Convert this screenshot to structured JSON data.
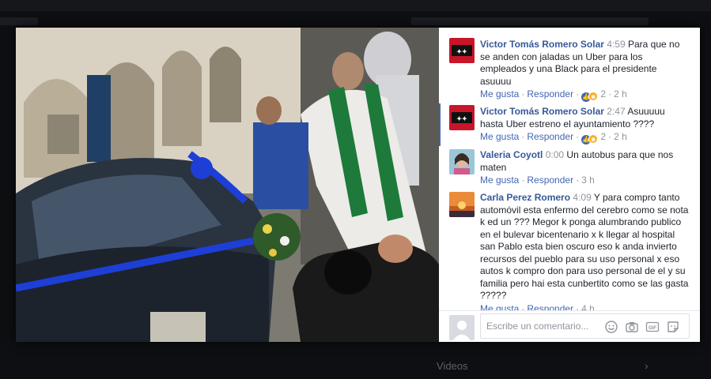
{
  "background": {
    "side_label": "Videos"
  },
  "comments": [
    {
      "author": "Victor Tomás Romero Solar",
      "time": "4:59",
      "text": "Para que no se anden con jaladas un Uber para los empleados y una Black para el presidente asuuuu",
      "like_label": "Me gusta",
      "reply_label": "Responder",
      "reactions_count": "2",
      "age": "2 h",
      "reaction_icons": [
        "like-icon",
        "haha-icon"
      ]
    },
    {
      "author": "Victor Tomás Romero Solar",
      "time": "2:47",
      "text": "Asuuuuu hasta Uber estreno el ayuntamiento ????",
      "like_label": "Me gusta",
      "reply_label": "Responder",
      "reactions_count": "2",
      "age": "2 h",
      "reaction_icons": [
        "like-icon",
        "haha-icon"
      ]
    },
    {
      "author": "Valeria Coyotl",
      "time": "0:00",
      "text": "Un autobus para que nos maten",
      "like_label": "Me gusta",
      "reply_label": "Responder",
      "age": "3 h"
    },
    {
      "author": "Carla Perez Romero",
      "time": "4:09",
      "text": "Y para compro tanto automóvil esta enfermo del cerebro como se nota k ed un ??? Megor k ponga alumbrando publico en el bulevar bicentenario x k llegar al hospital san Pablo esta bien oscuro eso k anda invierto recursos del pueblo para su uso personal x eso autos k compro don para uso personal de el y su familia pero hai esta cunbertito como se las gasta ?????",
      "like_label": "Me gusta",
      "reply_label": "Responder",
      "age": "4 h"
    }
  ],
  "composer": {
    "placeholder": "Escribe un comentario...",
    "icons": [
      "emoji-icon",
      "camera-icon",
      "gif-icon",
      "sticker-icon"
    ],
    "gif_label": "GIF"
  },
  "colors": {
    "link": "#365899",
    "action": "#4267b2",
    "meta": "#90949c"
  }
}
